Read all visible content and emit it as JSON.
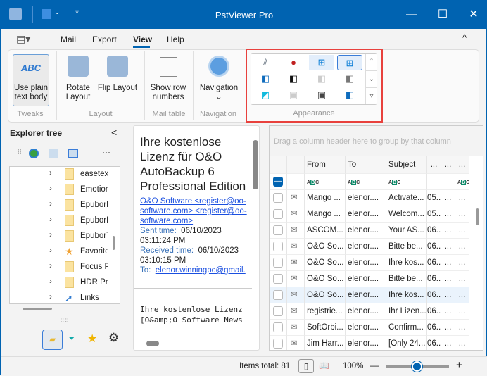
{
  "window": {
    "title": "PstViewer Pro",
    "minimize": "—",
    "maximize": "☐",
    "close": "✕"
  },
  "menu": {
    "tabs": [
      "Mail",
      "Export",
      "View",
      "Help"
    ],
    "active": "View",
    "collapse": "^"
  },
  "ribbon": {
    "tweaks": {
      "label": "Tweaks",
      "button": "Use plain text body",
      "icon_text": "ABC"
    },
    "layout": {
      "label": "Layout",
      "rotate": "Rotate Layout",
      "flip": "Flip Layout"
    },
    "mail_table": {
      "label": "Mail table",
      "show_row_numbers": "Show row numbers"
    },
    "navigation": {
      "label": "Navigation",
      "button": "Navigation"
    },
    "appearance": {
      "label": "Appearance",
      "highlight_color": "#e8413d"
    }
  },
  "explorer": {
    "title": "Explorer tree",
    "collapse": "<",
    "more": "···",
    "items": [
      {
        "label": "easetex",
        "icon": "folder"
      },
      {
        "label": "Emotion",
        "icon": "folder"
      },
      {
        "label": "EpuborK",
        "icon": "folder"
      },
      {
        "label": "EpuborN",
        "icon": "folder"
      },
      {
        "label": "EpuborT",
        "icon": "folder"
      },
      {
        "label": "Favorite",
        "icon": "star"
      },
      {
        "label": "Focus Pr",
        "icon": "folder"
      },
      {
        "label": "HDR Pro",
        "icon": "folder"
      },
      {
        "label": "Links",
        "icon": "link-arrow"
      }
    ]
  },
  "preview": {
    "title": "Ihre kostenlose Lizenz für O&O AutoBackup 6 Professional Edition",
    "from": "O&O Software <register@oo-software.com> <register@oo-software.com>",
    "sent_label": "Sent time:",
    "sent": "06/10/2023 03:11:24 PM",
    "received_label": "Received time:",
    "received": "06/10/2023 03:10:15 PM",
    "to_label": "To:",
    "to": "elenor.winningpc@gmail.",
    "body": "Ihre kostenlose Lizenz\n[O&amp;O Software News"
  },
  "grid": {
    "group_hint": "Drag a column header here to group by that column",
    "columns": [
      "From",
      "To",
      "Subject",
      "...",
      "...",
      "..."
    ],
    "rows": [
      {
        "from": "Mango ...",
        "to": "elenor....",
        "subject": "Activate...",
        "date": "05...",
        "c5": "...",
        "c6": "..."
      },
      {
        "from": "Mango ...",
        "to": "elenor....",
        "subject": "Welcom...",
        "date": "05...",
        "c5": "...",
        "c6": "..."
      },
      {
        "from": "ASCOM...",
        "to": "elenor....",
        "subject": "Your AS...",
        "date": "06...",
        "c5": "...",
        "c6": "..."
      },
      {
        "from": "O&O So...",
        "to": "elenor....",
        "subject": "Bitte be...",
        "date": "06...",
        "c5": "...",
        "c6": "..."
      },
      {
        "from": "O&O So...",
        "to": "elenor....",
        "subject": "Ihre kos...",
        "date": "06...",
        "c5": "...",
        "c6": "..."
      },
      {
        "from": "O&O So...",
        "to": "elenor....",
        "subject": "Bitte be...",
        "date": "06...",
        "c5": "...",
        "c6": "..."
      },
      {
        "from": "O&O So...",
        "to": "elenor....",
        "subject": "Ihre kos...",
        "date": "06...",
        "c5": "...",
        "c6": "...",
        "selected": true
      },
      {
        "from": "registrie...",
        "to": "elenor....",
        "subject": "Ihr Lizen...",
        "date": "06...",
        "c5": "...",
        "c6": "..."
      },
      {
        "from": "SoftOrbi...",
        "to": "elenor....",
        "subject": "Confirm...",
        "date": "06...",
        "c5": "...",
        "c6": "..."
      },
      {
        "from": "Jim Harr...",
        "to": "elenor....",
        "subject": "[Only 24...",
        "date": "06...",
        "c5": "...",
        "c6": "..."
      }
    ]
  },
  "status": {
    "items_total": "Items total: 81",
    "zoom": "100%",
    "zoom_level": 0.5,
    "minus": "—",
    "plus": "+"
  },
  "colors": {
    "accent": "#0063b1",
    "link": "#1a4fe0",
    "label_blue": "#3b73b9"
  }
}
